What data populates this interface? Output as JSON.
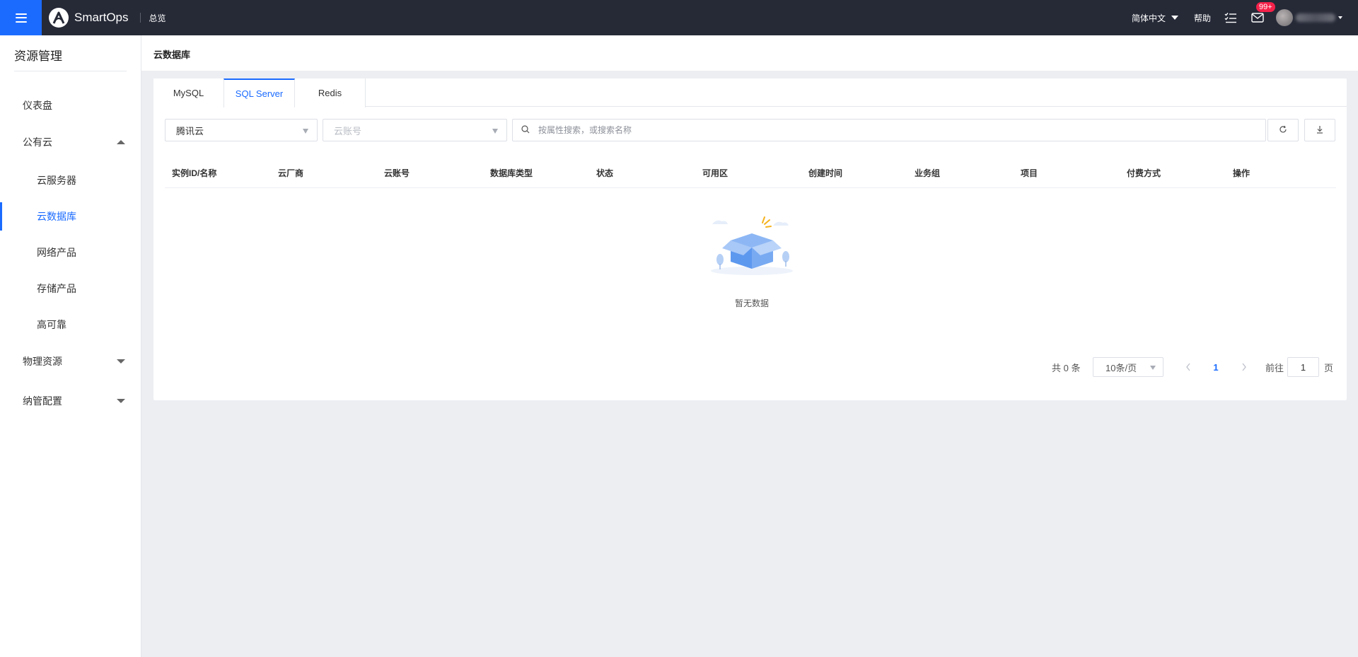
{
  "topbar": {
    "brand": "SmartOps",
    "nav_overview": "总览",
    "language": "简体中文",
    "help": "帮助",
    "mail_badge": "99+"
  },
  "sidebar": {
    "title": "资源管理",
    "items": [
      {
        "label": "仪表盘"
      },
      {
        "label": "公有云"
      },
      {
        "label": "云服务器"
      },
      {
        "label": "云数据库"
      },
      {
        "label": "网络产品"
      },
      {
        "label": "存储产品"
      },
      {
        "label": "高可靠"
      },
      {
        "label": "物理资源"
      },
      {
        "label": "纳管配置"
      }
    ]
  },
  "breadcrumb": "云数据库",
  "tabs": [
    "MySQL",
    "SQL Server",
    "Redis"
  ],
  "active_tab": "SQL Server",
  "filters": {
    "vendor_value": "腾讯云",
    "account_placeholder": "云账号",
    "search_placeholder": "按属性搜索，或搜索名称"
  },
  "table": {
    "columns": [
      "实例ID/名称",
      "云厂商",
      "云账号",
      "数据库类型",
      "状态",
      "可用区",
      "创建时间",
      "业务组",
      "项目",
      "付费方式",
      "操作"
    ],
    "empty_text": "暂无数据"
  },
  "pagination": {
    "total_text": "共 0 条",
    "page_size": "10条/页",
    "current_page": "1",
    "goto_prefix": "前往",
    "goto_value": "1",
    "goto_suffix": "页"
  },
  "colors": {
    "accent": "#1b6bff",
    "topbar_bg": "#262a37",
    "badge": "#f5224a"
  }
}
